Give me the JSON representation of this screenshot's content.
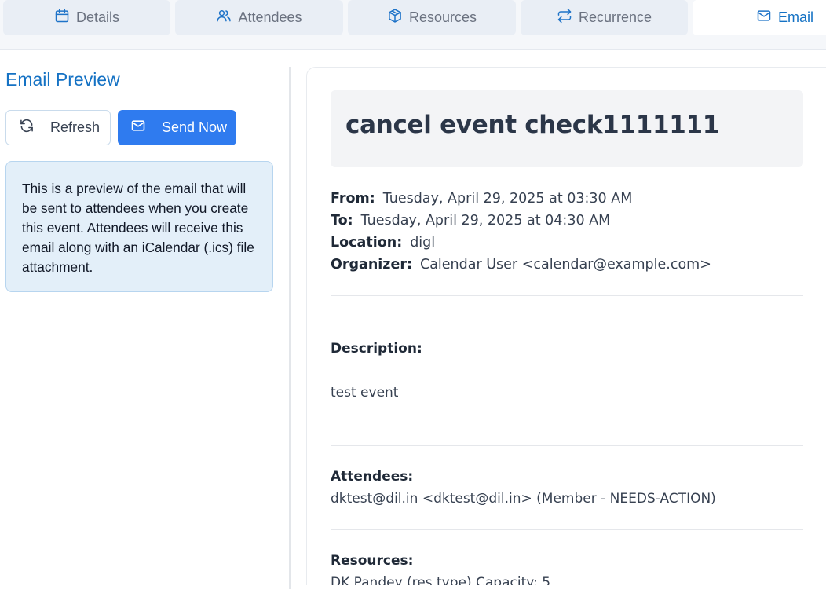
{
  "tabs": [
    {
      "label": "Details",
      "icon": "calendar-icon"
    },
    {
      "label": "Attendees",
      "icon": "users-icon"
    },
    {
      "label": "Resources",
      "icon": "box-icon"
    },
    {
      "label": "Recurrence",
      "icon": "repeat-icon"
    },
    {
      "label": "Email",
      "icon": "mail-icon",
      "active": true
    }
  ],
  "left": {
    "title": "Email Preview",
    "refresh_label": "Refresh",
    "send_label": "Send Now",
    "info_text": "This is a preview of the email that will be sent to attendees when you create this event. Attendees will receive this email along with an iCalendar (.ics) file attachment."
  },
  "email": {
    "subject": "cancel event check1111111",
    "from_label": "From:",
    "from_value": "Tuesday, April 29, 2025 at 03:30 AM",
    "to_label": "To:",
    "to_value": "Tuesday, April 29, 2025 at 04:30 AM",
    "location_label": "Location:",
    "location_value": "digl",
    "organizer_label": "Organizer:",
    "organizer_value": "Calendar User <calendar@example.com>",
    "description_label": "Description:",
    "description_value": "test event",
    "attendees_label": "Attendees:",
    "attendees_value": "dktest@dil.in <dktest@dil.in> (Member - NEEDS-ACTION)",
    "resources_label": "Resources:",
    "resources_value": "DK Pandey (res type) Capacity: 5"
  },
  "colors": {
    "accent": "#1572c4",
    "send_button": "#2f7bef",
    "info_bg": "#e3eff9"
  }
}
